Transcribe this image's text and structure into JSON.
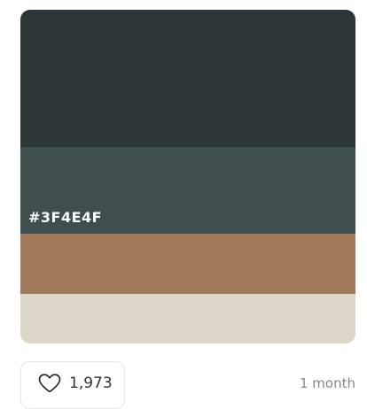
{
  "palette": {
    "colors": [
      "#2C3639",
      "#3F4E4F",
      "#A27B5C",
      "#DCD7C9"
    ],
    "hovered_hex_label": "#3F4E4F"
  },
  "likes": {
    "icon": "heart-icon",
    "count": "1,973"
  },
  "age": "1 month"
}
